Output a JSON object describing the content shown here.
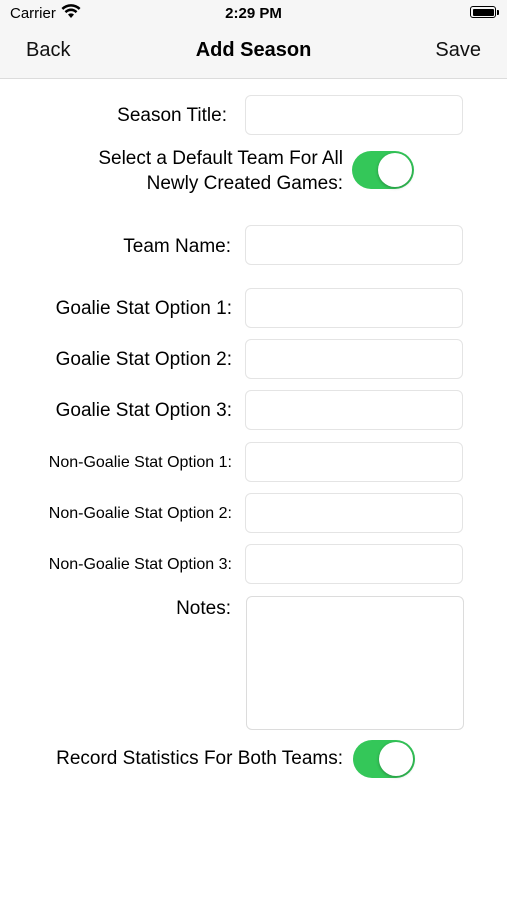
{
  "status_bar": {
    "carrier": "Carrier",
    "time": "2:29 PM"
  },
  "nav": {
    "back": "Back",
    "title": "Add Season",
    "save": "Save"
  },
  "form": {
    "season_title": {
      "label": "Season Title:",
      "value": ""
    },
    "default_team": {
      "label_line1": "Select a Default Team For All",
      "label_line2": "Newly Created Games:",
      "on": true
    },
    "team_name": {
      "label": "Team Name:",
      "value": ""
    },
    "goalie_stat_1": {
      "label": "Goalie Stat Option 1:",
      "value": ""
    },
    "goalie_stat_2": {
      "label": "Goalie Stat Option 2:",
      "value": ""
    },
    "goalie_stat_3": {
      "label": "Goalie Stat Option 3:",
      "value": ""
    },
    "non_goalie_stat_1": {
      "label": "Non-Goalie Stat Option 1:",
      "value": ""
    },
    "non_goalie_stat_2": {
      "label": "Non-Goalie Stat Option 2:",
      "value": ""
    },
    "non_goalie_stat_3": {
      "label": "Non-Goalie Stat Option 3:",
      "value": ""
    },
    "notes": {
      "label": "Notes:",
      "value": ""
    },
    "record_both": {
      "label": "Record Statistics For Both Teams:",
      "on": true
    }
  },
  "colors": {
    "toggle_on": "#34c759",
    "nav_background": "#f6f6f6"
  }
}
